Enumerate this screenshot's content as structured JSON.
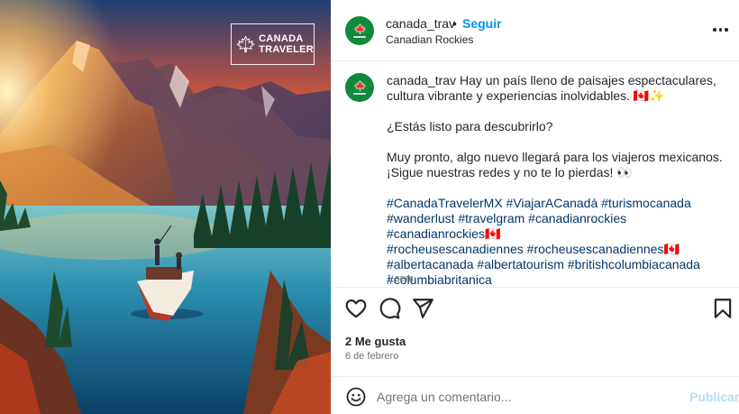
{
  "post": {
    "image_brand": {
      "line1": "CANADA",
      "line2": "TRAVELER"
    },
    "header": {
      "username": "canada_trav",
      "separator": "•",
      "follow_label": "Seguir",
      "location": "Canadian Rockies",
      "more_icon": "more-horizontal-icon"
    },
    "caption": {
      "username": "canada_trav",
      "line1": "Hay un país lleno de paisajes espectaculares, cultura vibrante y experiencias inolvidables. 🇨🇦✨",
      "line2": "¿Estás listo para descubrirlo?",
      "line3a": "Muy pronto, algo nuevo llegará para los viajeros mexicanos.",
      "line3b": "¡Sigue nuestras redes y no te lo pierdas! 👀",
      "hashtags": [
        "#CanadaTravelerMX #ViajarACanadá #turismocanada",
        "#wanderlust #travelgram #canadianrockies #canadianrockies🇨🇦",
        "#rocheusescanadiennes #rocheusescanadiennes🇨🇦",
        "#albertacanada #albertatourism #britishcolumbiacanada",
        "#columbiabritanica"
      ],
      "time_ago": "1 sem"
    },
    "actions": {
      "like_icon": "heart-icon",
      "comment_icon": "comment-icon",
      "share_icon": "send-icon",
      "save_icon": "bookmark-icon"
    },
    "likes": "2 Me gusta",
    "date": "6 de febrero",
    "comment": {
      "emoji_icon": "emoji-icon",
      "placeholder": "Agrega un comentario...",
      "post_label": "Publicar"
    },
    "colors": {
      "accent": "#0095f6",
      "hashtag": "#00376b",
      "avatar_bg": "#0f8a3c",
      "publish_disabled": "#b2dffc"
    }
  }
}
